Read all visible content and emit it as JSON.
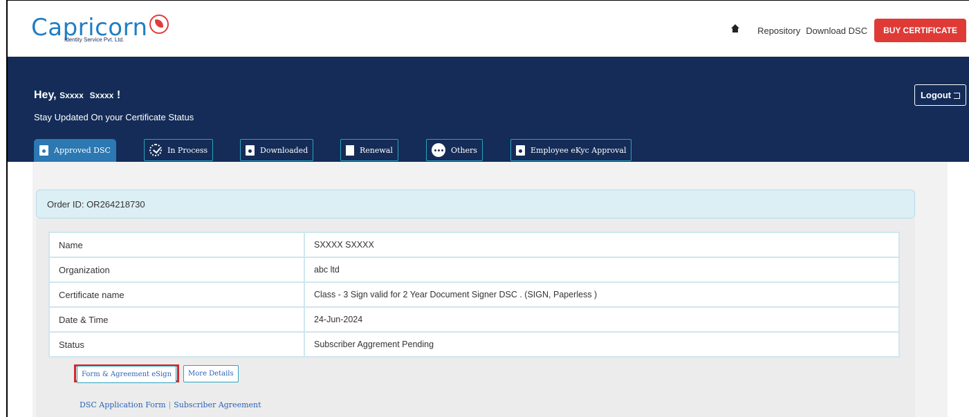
{
  "brand": {
    "name": "Capricorn",
    "subtitle": "Identity Service Pvt. Ltd."
  },
  "nav": {
    "home_icon": "home-icon",
    "links": [
      "Repository",
      "Download DSC"
    ],
    "buy_label": "BUY CERTIFICATE"
  },
  "banner": {
    "greeting_prefix": "Hey,",
    "user_first": "Sxxxx",
    "user_last": "Sxxxx",
    "greeting_suffix": "!",
    "subtitle": "Stay Updated On your Certificate Status",
    "logout_label": "Logout"
  },
  "tabs": [
    {
      "label": "Approved DSC",
      "icon": "doc-icon",
      "active": true
    },
    {
      "label": "In Process",
      "icon": "progress-icon",
      "active": false
    },
    {
      "label": "Downloaded",
      "icon": "doc-icon",
      "active": false
    },
    {
      "label": "Renewal",
      "icon": "doc-icon",
      "active": false
    },
    {
      "label": "Others",
      "icon": "more-icon",
      "active": false
    },
    {
      "label": "Employee eKyc Approval",
      "icon": "doc-icon",
      "active": false
    }
  ],
  "order": {
    "label": "Order ID: OR264218730"
  },
  "details": [
    {
      "key": "Name",
      "value": "SXXXX SXXXX"
    },
    {
      "key": "Organization",
      "value": "abc ltd"
    },
    {
      "key": "Certificate name",
      "value": "Class - 3 Sign valid for 2 Year Document Signer DSC . (SIGN, Paperless )"
    },
    {
      "key": "Date & Time",
      "value": "24-Jun-2024"
    },
    {
      "key": "Status",
      "value": "Subscriber Aggrement Pending"
    }
  ],
  "actions": {
    "esign_label": "Form & Agreement eSign",
    "more_label": "More Details"
  },
  "links": {
    "form_label": "DSC Application Form",
    "separator": "|",
    "agreement_label": "Subscriber Agreement"
  },
  "colors": {
    "banner": "#142c57",
    "buy": "#e03a36",
    "status": "#d9413c",
    "highlight": "#d8262b"
  }
}
